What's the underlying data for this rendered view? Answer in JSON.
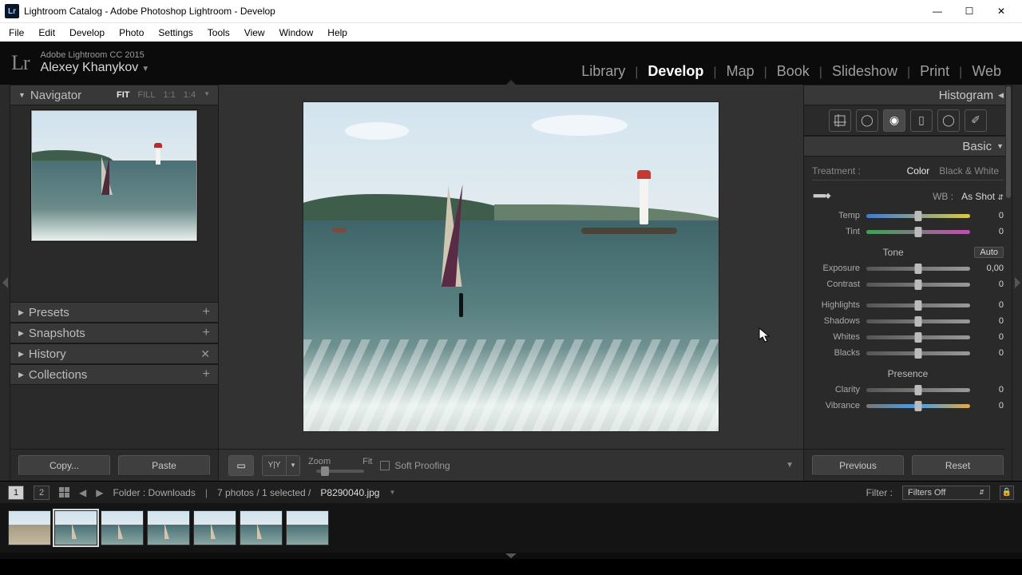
{
  "window": {
    "title": "Lightroom Catalog - Adobe Photoshop Lightroom - Develop"
  },
  "menus": [
    "File",
    "Edit",
    "Develop",
    "Photo",
    "Settings",
    "Tools",
    "View",
    "Window",
    "Help"
  ],
  "identity": {
    "edition": "Adobe Lightroom CC 2015",
    "user": "Alexey Khanykov"
  },
  "modules": {
    "items": [
      "Library",
      "Develop",
      "Map",
      "Book",
      "Slideshow",
      "Print",
      "Web"
    ],
    "active": "Develop"
  },
  "left": {
    "navigator": {
      "title": "Navigator",
      "zoom": {
        "options": [
          "FIT",
          "FILL",
          "1:1",
          "1:4"
        ],
        "active": "FIT"
      }
    },
    "panels": [
      {
        "title": "Presets",
        "action": "add"
      },
      {
        "title": "Snapshots",
        "action": "add"
      },
      {
        "title": "History",
        "action": "close"
      },
      {
        "title": "Collections",
        "action": "add"
      }
    ],
    "copy": "Copy...",
    "paste": "Paste"
  },
  "center": {
    "toolbar": {
      "zoom_label": "Zoom",
      "fit_label": "Fit",
      "soft_proof": "Soft Proofing"
    }
  },
  "right": {
    "histogram": "Histogram",
    "basic": {
      "title": "Basic",
      "treatment_label": "Treatment :",
      "treatment_color": "Color",
      "treatment_bw": "Black & White",
      "wb_label": "WB :",
      "wb_value": "As Shot",
      "temp": {
        "label": "Temp",
        "value": "0"
      },
      "tint": {
        "label": "Tint",
        "value": "0"
      },
      "tone_label": "Tone",
      "auto": "Auto",
      "exposure": {
        "label": "Exposure",
        "value": "0,00"
      },
      "contrast": {
        "label": "Contrast",
        "value": "0"
      },
      "highlights": {
        "label": "Highlights",
        "value": "0"
      },
      "shadows": {
        "label": "Shadows",
        "value": "0"
      },
      "whites": {
        "label": "Whites",
        "value": "0"
      },
      "blacks": {
        "label": "Blacks",
        "value": "0"
      },
      "presence_label": "Presence",
      "clarity": {
        "label": "Clarity",
        "value": "0"
      },
      "vibrance": {
        "label": "Vibrance",
        "value": "0"
      }
    },
    "previous": "Previous",
    "reset": "Reset"
  },
  "filmstrip": {
    "pages": [
      "1",
      "2"
    ],
    "folder": "Folder : Downloads",
    "count": "7 photos / 1 selected /",
    "file": "P8290040.jpg",
    "filter_label": "Filter :",
    "filter_value": "Filters Off"
  }
}
